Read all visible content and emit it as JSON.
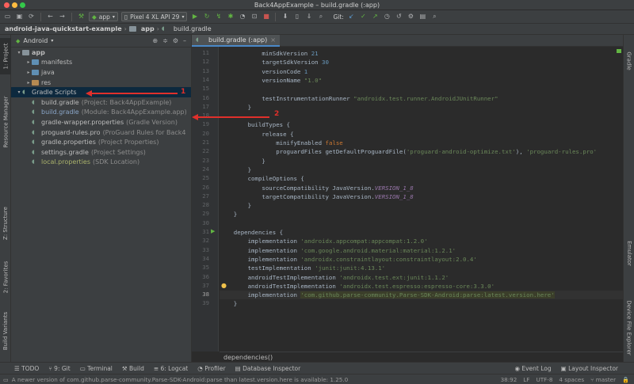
{
  "window": {
    "title": "Back4AppExample – build.gradle (:app)"
  },
  "toolbar": {
    "run_config": "app",
    "device": "Pixel 4 XL API 29",
    "git_label": "Git:"
  },
  "breadcrumb": [
    "android-java-quickstart-example",
    "app",
    "build.gradle"
  ],
  "left_tabs": [
    "1: Project",
    "Resource Manager",
    "Z: Structure",
    "2: Favorites",
    "Build Variants"
  ],
  "right_tabs": [
    "Gradle",
    "Emulator",
    "Device File Explorer"
  ],
  "project": {
    "view_mode": "Android",
    "tree": [
      {
        "indent": 0,
        "arrow": "▾",
        "icon": "folder",
        "name": "app",
        "hint": "",
        "style": "bold"
      },
      {
        "indent": 1,
        "arrow": "▸",
        "icon": "folder-blue",
        "name": "manifests",
        "hint": ""
      },
      {
        "indent": 1,
        "arrow": "▸",
        "icon": "folder-blue",
        "name": "java",
        "hint": ""
      },
      {
        "indent": 1,
        "arrow": "▸",
        "icon": "folder-orange",
        "name": "res",
        "hint": ""
      },
      {
        "indent": 0,
        "arrow": "▾",
        "icon": "gradle",
        "name": "Gradle Scripts",
        "hint": "",
        "selected": true
      },
      {
        "indent": 1,
        "arrow": "",
        "icon": "gradle",
        "name": "build.gradle",
        "hint": "(Project: Back4AppExample)"
      },
      {
        "indent": 1,
        "arrow": "",
        "icon": "gradle",
        "name": "build.gradle",
        "hint": "(Module: Back4AppExample.app)",
        "style": "blue"
      },
      {
        "indent": 1,
        "arrow": "",
        "icon": "gradle",
        "name": "gradle-wrapper.properties",
        "hint": "(Gradle Version)"
      },
      {
        "indent": 1,
        "arrow": "",
        "icon": "gradle",
        "name": "proguard-rules.pro",
        "hint": "(ProGuard Rules for Back4"
      },
      {
        "indent": 1,
        "arrow": "",
        "icon": "gradle",
        "name": "gradle.properties",
        "hint": "(Project Properties)"
      },
      {
        "indent": 1,
        "arrow": "",
        "icon": "gradle",
        "name": "settings.gradle",
        "hint": "(Project Settings)"
      },
      {
        "indent": 1,
        "arrow": "",
        "icon": "gradle",
        "name": "local.properties",
        "hint": "(SDK Location)",
        "style": "green"
      }
    ]
  },
  "editor": {
    "tab_label": "build.gradle (:app)",
    "current_line": 38,
    "lines": [
      {
        "n": 11,
        "html": "            minSdkVersion <span class=\"num\">21</span>"
      },
      {
        "n": 12,
        "html": "            targetSdkVersion <span class=\"num\">30</span>"
      },
      {
        "n": 13,
        "html": "            versionCode <span class=\"num\">1</span>"
      },
      {
        "n": 14,
        "html": "            versionName <span class=\"str\">\"1.0\"</span>"
      },
      {
        "n": 15,
        "html": ""
      },
      {
        "n": 16,
        "html": "            testInstrumentationRunner <span class=\"str\">\"androidx.test.runner.AndroidJUnitRunner\"</span>"
      },
      {
        "n": 17,
        "html": "        }"
      },
      {
        "n": 18,
        "html": ""
      },
      {
        "n": 19,
        "html": "        buildTypes {"
      },
      {
        "n": 20,
        "html": "            release {"
      },
      {
        "n": 21,
        "html": "                minifyEnabled <span class=\"kw\">false</span>"
      },
      {
        "n": 22,
        "html": "                proguardFiles getDefaultProguardFile(<span class=\"str\">'proguard-android-optimize.txt'</span>), <span class=\"str\">'proguard-rules.pro'</span>"
      },
      {
        "n": 23,
        "html": "            }"
      },
      {
        "n": 24,
        "html": "        }"
      },
      {
        "n": 25,
        "html": "        compileOptions {"
      },
      {
        "n": 26,
        "html": "            sourceCompatibility JavaVersion.<span class=\"ital\">VERSION_1_8</span>"
      },
      {
        "n": 27,
        "html": "            targetCompatibility JavaVersion.<span class=\"ital\">VERSION_1_8</span>"
      },
      {
        "n": 28,
        "html": "        }"
      },
      {
        "n": 29,
        "html": "    }"
      },
      {
        "n": 30,
        "html": ""
      },
      {
        "n": 31,
        "html": "    dependencies {"
      },
      {
        "n": 32,
        "html": "        implementation <span class=\"str\">'androidx.appcompat:appcompat:1.2.0'</span>"
      },
      {
        "n": 33,
        "html": "        implementation <span class=\"str\">'com.google.android.material:material:1.2.1'</span>"
      },
      {
        "n": 34,
        "html": "        implementation <span class=\"str\">'androidx.constraintlayout:constraintlayout:2.0.4'</span>"
      },
      {
        "n": 35,
        "html": "        testImplementation <span class=\"str\">'junit:junit:4.13.1'</span>"
      },
      {
        "n": 36,
        "html": "        androidTestImplementation <span class=\"str\">'androidx.test.ext:junit:1.1.2'</span>"
      },
      {
        "n": 37,
        "html": "        androidTestImplementation <span class=\"str\">'androidx.test.espresso:espresso-core:3.3.0'</span>"
      },
      {
        "n": 38,
        "html": "        implementation <span class=\"hl\">'com.github.parse-community.Parse-SDK-Android:parse:latest.version.here'</span>"
      },
      {
        "n": 39,
        "html": "    }"
      }
    ],
    "breadcrumb": "dependencies()"
  },
  "annotations": {
    "arrow1": "1",
    "arrow2": "2"
  },
  "bottom_tools": {
    "left": [
      "TODO",
      "9: Git",
      "Terminal",
      "Build",
      "6: Logcat",
      "Profiler",
      "Database Inspector"
    ],
    "right": [
      "Event Log",
      "Layout Inspector"
    ]
  },
  "status": {
    "message": "A newer version of com.github.parse-community.Parse-SDK-Android:parse than latest.version.here is available: 1.25.0",
    "position": "38:92",
    "line_sep": "LF",
    "encoding": "UTF-8",
    "indent": "4 spaces",
    "branch": "master"
  }
}
